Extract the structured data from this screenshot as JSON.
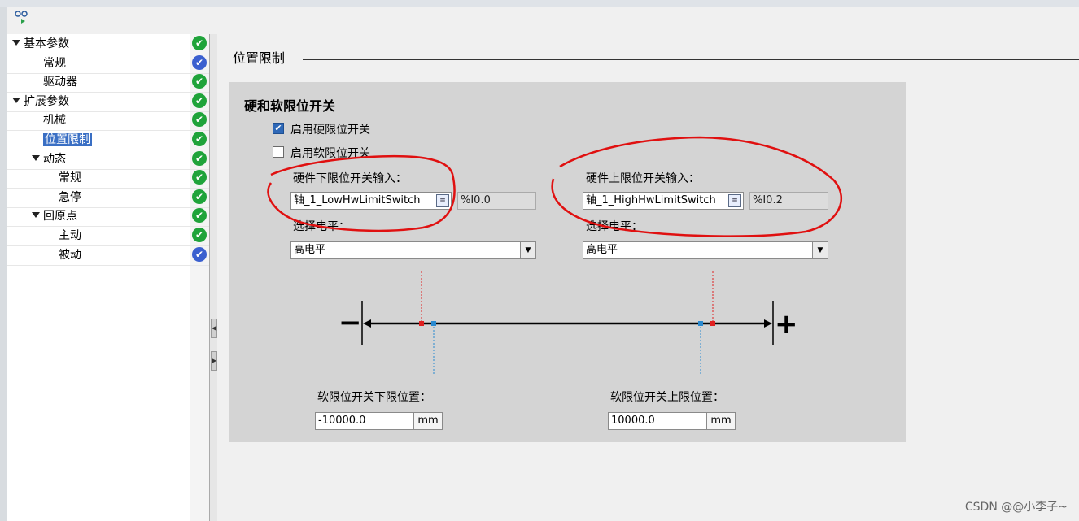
{
  "tree": {
    "items": [
      {
        "label": "基本参数",
        "level": 0,
        "expanded": true,
        "status": "ok"
      },
      {
        "label": "常规",
        "level": 1,
        "status": "ok-blue"
      },
      {
        "label": "驱动器",
        "level": 1,
        "status": "ok"
      },
      {
        "label": "扩展参数",
        "level": 0,
        "expanded": true,
        "status": "ok"
      },
      {
        "label": "机械",
        "level": 1,
        "status": "ok"
      },
      {
        "label": "位置限制",
        "level": 1,
        "status": "ok",
        "selected": true
      },
      {
        "label": "动态",
        "level": 1,
        "expanded": true,
        "status": "ok"
      },
      {
        "label": "常规",
        "level": 2,
        "status": "ok"
      },
      {
        "label": "急停",
        "level": 2,
        "status": "ok"
      },
      {
        "label": "回原点",
        "level": 1,
        "expanded": true,
        "status": "ok"
      },
      {
        "label": "主动",
        "level": 2,
        "status": "ok"
      },
      {
        "label": "被动",
        "level": 2,
        "status": "ok-blue"
      }
    ]
  },
  "main": {
    "section_title": "位置限制",
    "panel_title": "硬和软限位开关",
    "enable_hw_label": "启用硬限位开关",
    "enable_hw_checked": true,
    "enable_sw_label": "启用软限位开关",
    "enable_sw_checked": false,
    "hw_low_label": "硬件下限位开关输入：",
    "hw_low_value": "轴_1_LowHwLimitSwitch",
    "hw_low_address": "%I0.0",
    "hw_low_level_label": "选择电平：",
    "hw_low_level": "高电平",
    "hw_high_label": "硬件上限位开关输入：",
    "hw_high_value": "轴_1_HighHwLimitSwitch",
    "hw_high_address": "%I0.2",
    "hw_high_level_label": "选择电平：",
    "hw_high_level": "高电平",
    "minus_sign": "−",
    "plus_sign": "+",
    "sw_low_label": "软限位开关下限位置：",
    "sw_low_value": "-10000.0",
    "sw_low_unit": "mm",
    "sw_high_label": "软限位开关上限位置：",
    "sw_high_value": "10000.0",
    "sw_high_unit": "mm"
  },
  "watermark": "CSDN @@小李子~",
  "colors": {
    "ok": "#1fa33a",
    "ok_blue": "#3a5fcf",
    "selection": "#3a6fc4",
    "hw_marker": "#e02020",
    "sw_marker": "#2a8ad0",
    "annotation": "#e01010"
  }
}
